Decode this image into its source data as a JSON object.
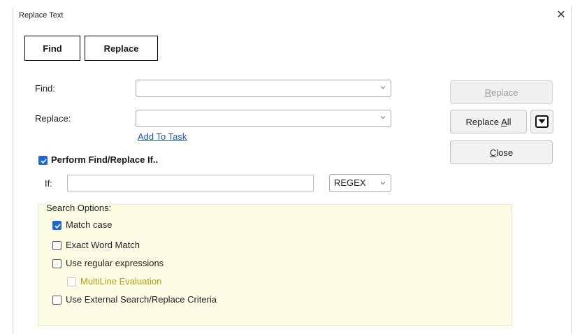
{
  "window": {
    "title": "Replace Text",
    "close_glyph": "✕"
  },
  "tabs": [
    {
      "label": "Find"
    },
    {
      "label": "Replace"
    }
  ],
  "find": {
    "label": "Find:",
    "value": ""
  },
  "replace": {
    "label": "Replace:",
    "value": ""
  },
  "add_to_task": "Add To Task",
  "perform_if": {
    "label": "Perform Find/Replace If..",
    "checked": true
  },
  "if_field": {
    "label": "If:",
    "value": "",
    "mode": "REGEX"
  },
  "buttons": {
    "replace": {
      "pre": "",
      "acc": "R",
      "post": "eplace"
    },
    "replace_all": {
      "pre": "Replace ",
      "acc": "A",
      "post": "ll"
    },
    "close": {
      "pre": "",
      "acc": "C",
      "post": "lose"
    }
  },
  "search_options": {
    "label": "Search Options:",
    "match_case": "Match case",
    "exact_word": "Exact Word Match",
    "regex": "Use regular expressions",
    "multiline": "MultiLine Evaluation",
    "external": "Use External Search/Replace Criteria"
  },
  "colors": {
    "accent": "#1e67d6",
    "link": "#1a55c8",
    "group_bg": "#fdfde6",
    "disabled_text": "#b0a014"
  },
  "icons": {
    "dropdown": "chevron-down-icon",
    "split": "dropdown-arrow-icon",
    "check": "check-icon"
  }
}
